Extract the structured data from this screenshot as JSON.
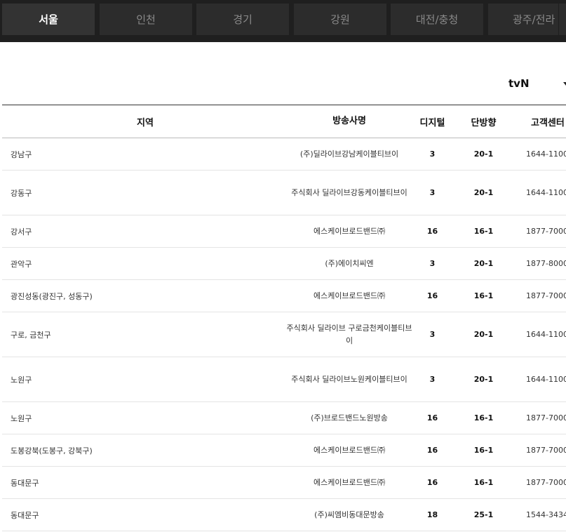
{
  "tabs": [
    {
      "label": "서울",
      "active": true
    },
    {
      "label": "인천",
      "active": false
    },
    {
      "label": "경기",
      "active": false
    },
    {
      "label": "강원",
      "active": false
    },
    {
      "label": "대전/충청",
      "active": false
    },
    {
      "label": "광주/전라",
      "active": false
    }
  ],
  "channel_select": {
    "value": "tvN"
  },
  "table": {
    "headers": {
      "region": "지역",
      "broadcaster": "방송사명",
      "digital": "디지털",
      "one_way": "단방향",
      "customer_center": "고객센터"
    },
    "rows": [
      {
        "region": "강남구",
        "broadcaster": "(주)딜라이브강남케이블티브이",
        "digital": "3",
        "one_way": "20-1",
        "customer_center": "1644-1100"
      },
      {
        "region": "강동구",
        "broadcaster": "주식회사 딜라이브강동케이블티브이",
        "digital": "3",
        "one_way": "20-1",
        "customer_center": "1644-1100"
      },
      {
        "region": "강서구",
        "broadcaster": "에스케이브로드밴드㈜",
        "digital": "16",
        "one_way": "16-1",
        "customer_center": "1877-7000"
      },
      {
        "region": "관악구",
        "broadcaster": "(주)에이치씨엔",
        "digital": "3",
        "one_way": "20-1",
        "customer_center": "1877-8000"
      },
      {
        "region": "광진성동(광진구, 성동구)",
        "broadcaster": "에스케이브로드밴드㈜",
        "digital": "16",
        "one_way": "16-1",
        "customer_center": "1877-7000"
      },
      {
        "region": "구로, 금천구",
        "broadcaster": "주식회사 딜라이브 구로금천케이블티브이",
        "digital": "3",
        "one_way": "20-1",
        "customer_center": "1644-1100"
      },
      {
        "region": "노원구",
        "broadcaster": "주식회사 딜라이브노원케이블티브이",
        "digital": "3",
        "one_way": "20-1",
        "customer_center": "1644-1100"
      },
      {
        "region": "노원구",
        "broadcaster": "(주)브로드밴드노원방송",
        "digital": "16",
        "one_way": "16-1",
        "customer_center": "1877-7000"
      },
      {
        "region": "도봉강북(도봉구, 강북구)",
        "broadcaster": "에스케이브로드밴드㈜",
        "digital": "16",
        "one_way": "16-1",
        "customer_center": "1877-7000"
      },
      {
        "region": "동대문구",
        "broadcaster": "에스케이브로드밴드㈜",
        "digital": "16",
        "one_way": "16-1",
        "customer_center": "1877-7000"
      },
      {
        "region": "동대문구",
        "broadcaster": "(주)씨엠비동대문방송",
        "digital": "18",
        "one_way": "25-1",
        "customer_center": "1544-3434"
      }
    ]
  }
}
